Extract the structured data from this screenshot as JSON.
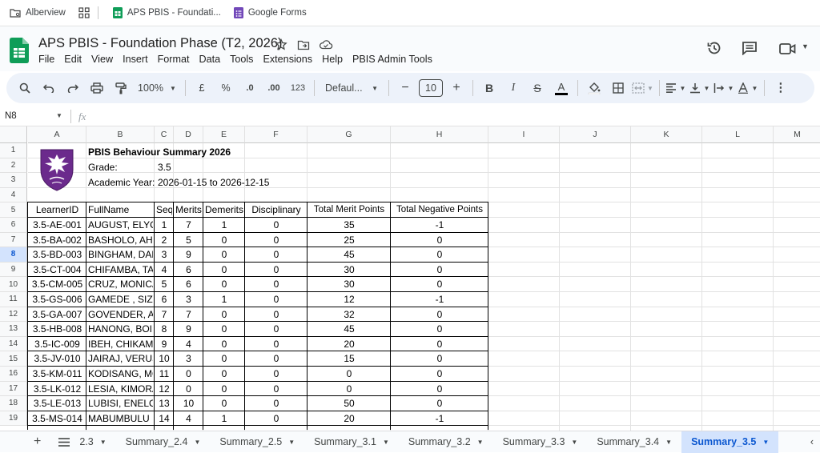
{
  "bookmarks": [
    {
      "label": "Alberview",
      "icon": "folder-settings-icon"
    },
    {
      "label": "",
      "icon": "apps-grid-icon"
    },
    {
      "label": "APS PBIS - Foundati...",
      "icon": "sheets-icon"
    },
    {
      "label": "Google Forms",
      "icon": "forms-icon"
    }
  ],
  "doc": {
    "title": "APS PBIS - Foundation Phase (T2, 2026)",
    "menu": [
      "File",
      "Edit",
      "View",
      "Insert",
      "Format",
      "Data",
      "Tools",
      "Extensions",
      "Help",
      "PBIS Admin Tools"
    ]
  },
  "toolbar": {
    "zoom": "100%",
    "currency": "£",
    "percent": "%",
    "dec_decrease": ".0",
    "dec_increase": ".00",
    "number_format": "123",
    "font": "Defaul...",
    "font_size": "10"
  },
  "formula_bar": {
    "cell_ref": "N8",
    "fx": "fx"
  },
  "grid": {
    "columns": [
      "A",
      "B",
      "C",
      "D",
      "E",
      "F",
      "G",
      "H",
      "I",
      "J",
      "K",
      "L",
      "M"
    ],
    "rows": [
      "1",
      "2",
      "3",
      "4",
      "5",
      "6",
      "7",
      "8",
      "9",
      "10",
      "11",
      "12",
      "13",
      "14",
      "15",
      "16",
      "17",
      "18",
      "19"
    ],
    "summary_title": "PBIS Behaviour Summary 2026",
    "grade_label": "Grade:",
    "grade_value": "3.5",
    "year_label": "Academic Year:",
    "year_value": "2026-01-15 to 2026-12-15",
    "logo": "school-crest-logo",
    "headers": [
      "LearnerID",
      "FullName",
      "Seq",
      "Merits",
      "Demerits",
      "Disciplinary",
      "Total Merit Points",
      "Total Negative Points"
    ],
    "table": [
      [
        "3.5-AE-001",
        "AUGUST, ELYC",
        "1",
        "7",
        "1",
        "0",
        "35",
        "-1"
      ],
      [
        "3.5-BA-002",
        "BASHOLO, AHI",
        "2",
        "5",
        "0",
        "0",
        "25",
        "0"
      ],
      [
        "3.5-BD-003",
        "BINGHAM, DAF",
        "3",
        "9",
        "0",
        "0",
        "45",
        "0"
      ],
      [
        "3.5-CT-004",
        "CHIFAMBA, TA",
        "4",
        "6",
        "0",
        "0",
        "30",
        "0"
      ],
      [
        "3.5-CM-005",
        "CRUZ, MONICA",
        "5",
        "6",
        "0",
        "0",
        "30",
        "0"
      ],
      [
        "3.5-GS-006",
        "GAMEDE , SIZV",
        "6",
        "3",
        "1",
        "0",
        "12",
        "-1"
      ],
      [
        "3.5-GA-007",
        "GOVENDER, A",
        "7",
        "7",
        "0",
        "0",
        "32",
        "0"
      ],
      [
        "3.5-HB-008",
        "HANONG, BOIF",
        "8",
        "9",
        "0",
        "0",
        "45",
        "0"
      ],
      [
        "3.5-IC-009",
        "IBEH, CHIKAMS",
        "9",
        "4",
        "0",
        "0",
        "20",
        "0"
      ],
      [
        "3.5-JV-010",
        "JAIRAJ, VERUS",
        "10",
        "3",
        "0",
        "0",
        "15",
        "0"
      ],
      [
        "3.5-KM-011",
        "KODISANG, MO",
        "11",
        "0",
        "0",
        "0",
        "0",
        "0"
      ],
      [
        "3.5-LK-012",
        "LESIA, KIMORA",
        "12",
        "0",
        "0",
        "0",
        "0",
        "0"
      ],
      [
        "3.5-LE-013",
        "LUBISI, ENELO",
        "13",
        "10",
        "0",
        "0",
        "50",
        "0"
      ],
      [
        "3.5-MS-014",
        "MABUMBULU",
        "14",
        "4",
        "1",
        "0",
        "20",
        "-1"
      ]
    ]
  },
  "sheet_tabs": [
    {
      "label": "2.3",
      "active": false
    },
    {
      "label": "Summary_2.4",
      "active": false
    },
    {
      "label": "Summary_2.5",
      "active": false
    },
    {
      "label": "Summary_3.1",
      "active": false
    },
    {
      "label": "Summary_3.2",
      "active": false
    },
    {
      "label": "Summary_3.3",
      "active": false
    },
    {
      "label": "Summary_3.4",
      "active": false
    },
    {
      "label": "Summary_3.5",
      "active": true
    }
  ],
  "colors": {
    "accent": "#0b57d0",
    "active_tab_bg": "#d3e3fd",
    "toolbar_bg": "#edf2fa",
    "sheets_green": "#0f9d58",
    "logo_purple": "#6b2a8c"
  }
}
